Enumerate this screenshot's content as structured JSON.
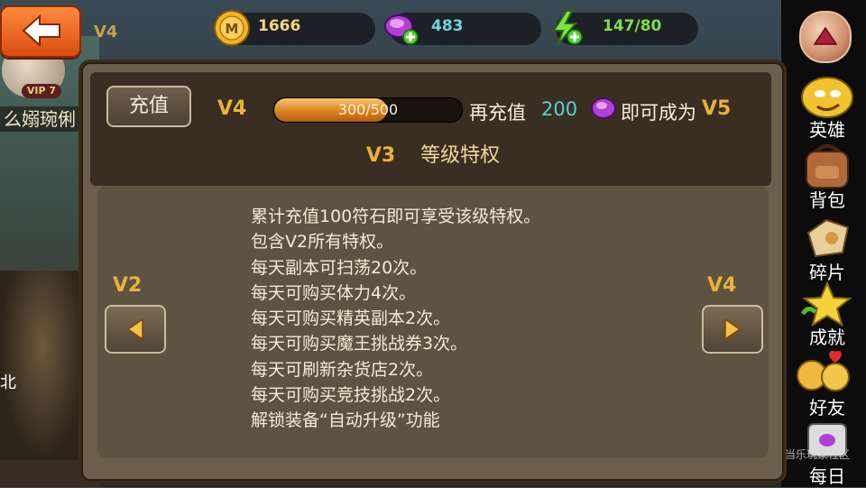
{
  "header": {
    "coins": "1666",
    "gems": "483",
    "energy": "147/80"
  },
  "background": {
    "vip_tag": "VIP 7",
    "v_tag": "V4",
    "player_name": "么嫋琬俐",
    "side_text": "北"
  },
  "sidebar": {
    "items": [
      {
        "label": "英雄",
        "icon": "hero-icon"
      },
      {
        "label": "背包",
        "icon": "backpack-icon"
      },
      {
        "label": "碎片",
        "icon": "fragments-icon"
      },
      {
        "label": "成就",
        "icon": "achievement-star-icon"
      },
      {
        "label": "好友",
        "icon": "friends-icon"
      },
      {
        "label": "每日",
        "icon": "daily-icon"
      }
    ]
  },
  "panel": {
    "recharge_label": "充值",
    "current_vip": "V4",
    "progress_text": "300/500",
    "progress_fraction": 0.6,
    "recharge_prefix": "再充值",
    "recharge_amount": "200",
    "become_text": "即可成为",
    "next_vip": "V5",
    "level_name": "V3",
    "level_suffix": "等级特权",
    "prev_label": "V2",
    "next_label": "V4",
    "privileges": [
      "累计充值100符石即可享受该级特权。",
      "包含V2所有特权。",
      "每天副本可扫荡20次。",
      "每天可购买体力4次。",
      "每天可购买精英副本2次。",
      "每天可购买魔王挑战券3次。",
      "每天可刷新杂货店2次。",
      "每天可购买竞技挑战2次。",
      "解锁装备“自动升级”功能"
    ]
  },
  "watermark": "当乐玩家社区",
  "colors": {
    "gold": "#e9b13a",
    "cyan": "#56d1d8",
    "green": "#7fe04a",
    "panel": "#6b5f4c"
  }
}
